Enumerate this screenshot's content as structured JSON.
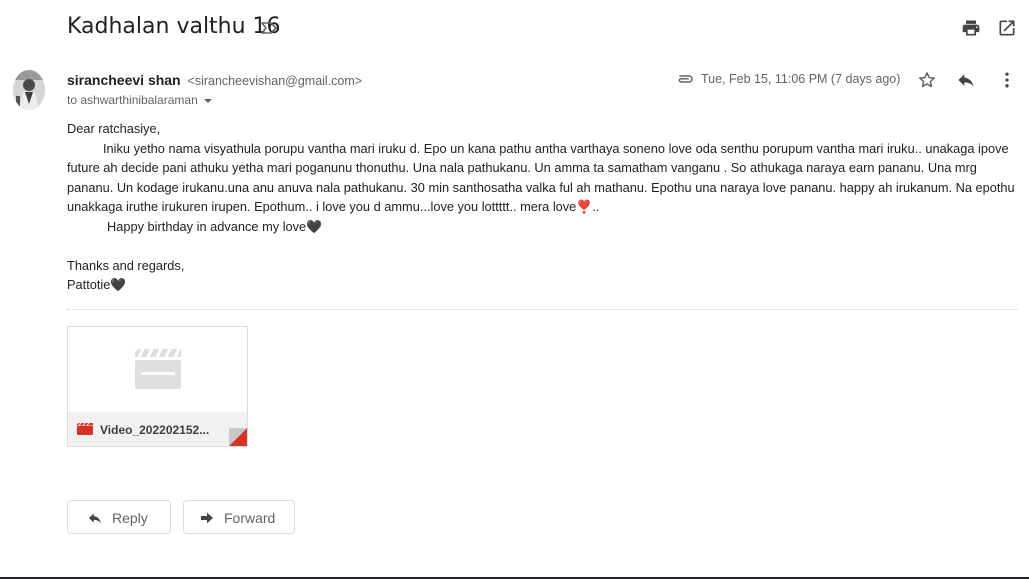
{
  "email": {
    "subject": "Kadhalan valthu 16",
    "sender": {
      "name": "sirancheevi shan",
      "email": "<sirancheevishan@gmail.com>"
    },
    "to": "to ashwarthinibalaraman",
    "date": "Tue, Feb 15, 11:06 PM (7 days ago)",
    "body": {
      "greeting": "Dear ratchasiye,",
      "paragraph": "Iniku yetho nama visyathula porupu vantha mari iruku d. Epo un kana pathu antha varthaya soneno love oda senthu porupum vantha mari iruku.. unakaga ipove future ah decide pani athuku yetha mari poganunu thonuthu. Una nala pathukanu. Un amma ta samatham vanganu . So athukaga naraya earn pananu. Una mrg pananu. Un kodage irukanu.una anu anuva nala pathukanu. 30 min santhosatha valka ful ah mathanu. Epothu una naraya love pananu. happy ah irukanum. Na epothu unakkaga iruthe irukuren irupen. Epothum.. i love you d ammu...love you lottttt.. mera love",
      "paragraph_heart": "❣️",
      "paragraph_end": "..",
      "birthday": "Happy birthday in advance my love",
      "birthday_heart": "🖤",
      "closing": "Thanks and regards,",
      "signature": "Pattotie",
      "signature_heart": "🖤"
    },
    "attachment": {
      "filename": "Video_202202152..."
    }
  },
  "actions": {
    "reply_label": "Reply",
    "forward_label": "Forward"
  },
  "icons": {
    "label": "label-outline-icon",
    "print": "print-icon",
    "popout": "open-in-new-window-icon",
    "attachment": "paperclip-icon",
    "star": "star-outline-icon",
    "reply": "reply-icon",
    "more": "more-vertical-icon",
    "video": "video-clapperboard-icon"
  },
  "colors": {
    "accent_red": "#d93025",
    "text_primary": "#202124",
    "text_secondary": "#5f6368"
  }
}
